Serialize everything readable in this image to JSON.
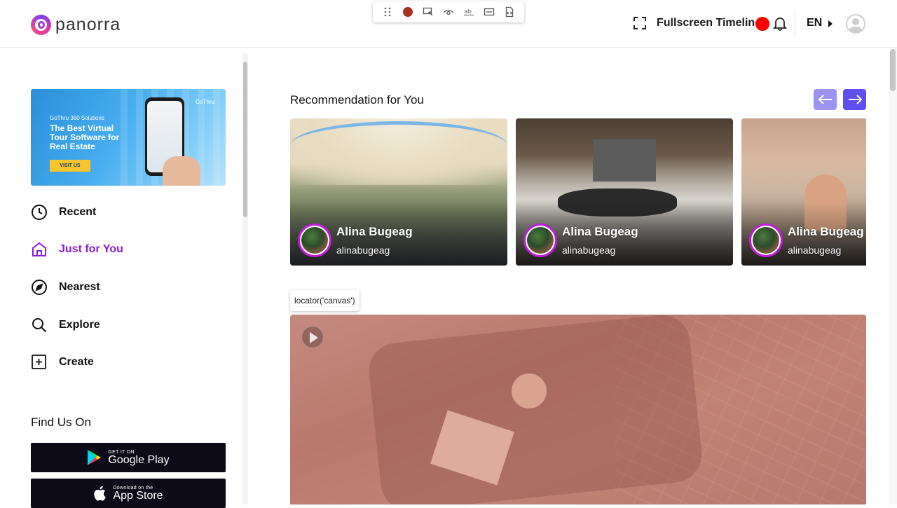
{
  "app": {
    "brand": "panorra"
  },
  "devtools": {
    "icons": [
      "drag-icon",
      "record-icon",
      "pick-locator-icon",
      "eye-icon",
      "text-assert-icon",
      "value-assert-icon",
      "snapshot-icon"
    ]
  },
  "header": {
    "fullscreen_label": "Fullscreen Timeline",
    "language": "EN"
  },
  "sidebar": {
    "banner": {
      "brand_small": "GoThru 360 Solutions",
      "headline": "The Best Virtual Tour Software for Real Estate",
      "cta": "VISIT US",
      "logo": "GoThru"
    },
    "nav": [
      {
        "label": "Recent",
        "icon": "clock-icon",
        "active": false
      },
      {
        "label": "Just for You",
        "icon": "home-icon",
        "active": true
      },
      {
        "label": "Nearest",
        "icon": "navigation-icon",
        "active": false
      },
      {
        "label": "Explore",
        "icon": "search-icon",
        "active": false
      },
      {
        "label": "Create",
        "icon": "plus-square-icon",
        "active": false
      }
    ],
    "find_us": "Find Us On",
    "stores": [
      {
        "small": "GET IT ON",
        "big": "Google Play"
      },
      {
        "small": "Download on the",
        "big": "App Store"
      }
    ]
  },
  "main": {
    "recommendation_title": "Recommendation for You",
    "cards": [
      {
        "name": "Alina Bugeag",
        "username": "alinabugeag"
      },
      {
        "name": "Alina Bugeag",
        "username": "alinabugeag"
      },
      {
        "name": "Alina Bugeag",
        "username": "alinabugeag"
      }
    ],
    "tooltip": "locator('canvas')"
  },
  "colors": {
    "accent_purple": "#8c1bd8",
    "arrow_next": "#5f4ef0",
    "arrow_prev": "#9d93f7",
    "record_red": "#ff0000"
  }
}
